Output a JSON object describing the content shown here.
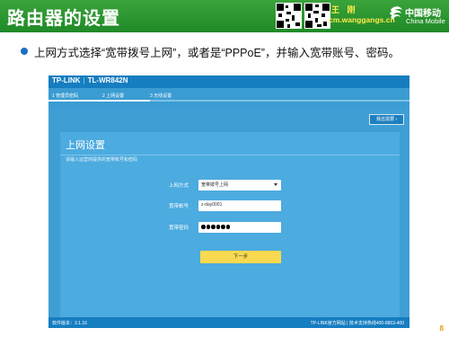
{
  "slide": {
    "title": "路由器的设置",
    "author_name": "王 刚",
    "author_url": "cm.wanggangs.cn",
    "logo_cn": "中国移动",
    "logo_en": "China Mobile",
    "bullet": "上网方式选择“宽带拨号上网”，或者是“PPPoE”，并输入宽带账号、密码。",
    "page_number": "8",
    "colors": {
      "header_green": "#1f8a27",
      "accent_yellow": "#ffe94a",
      "bullet_blue": "#1d6fc4"
    }
  },
  "router": {
    "brand": "TP-LINK",
    "model": "TL-WR842N",
    "steps": [
      {
        "label": "1 管理员密码",
        "state": "done"
      },
      {
        "label": "2 上网设置",
        "state": "active"
      },
      {
        "label": "3 无线设置",
        "state": "pending"
      }
    ],
    "help_button": "我还需要 ›",
    "panel": {
      "title": "上网设置",
      "subtitle": "请输入运营商提供的宽带账号和密码",
      "fields": [
        {
          "label": "上网方式",
          "value": "宽带拨号上网",
          "type": "select"
        },
        {
          "label": "宽带帐号",
          "value": "z-day0001",
          "type": "text"
        },
        {
          "label": "宽带密码",
          "value": "●●●●●●",
          "type": "password"
        }
      ],
      "next_button": "下一步"
    },
    "footer_left": "软件版本：3.1.16",
    "footer_right": "TP-LINK官方网站 | 技术支持热线400-8863-400",
    "colors": {
      "bg": "#3f9fd4",
      "topbar": "#157dc0",
      "button": "#f9d94f"
    }
  }
}
